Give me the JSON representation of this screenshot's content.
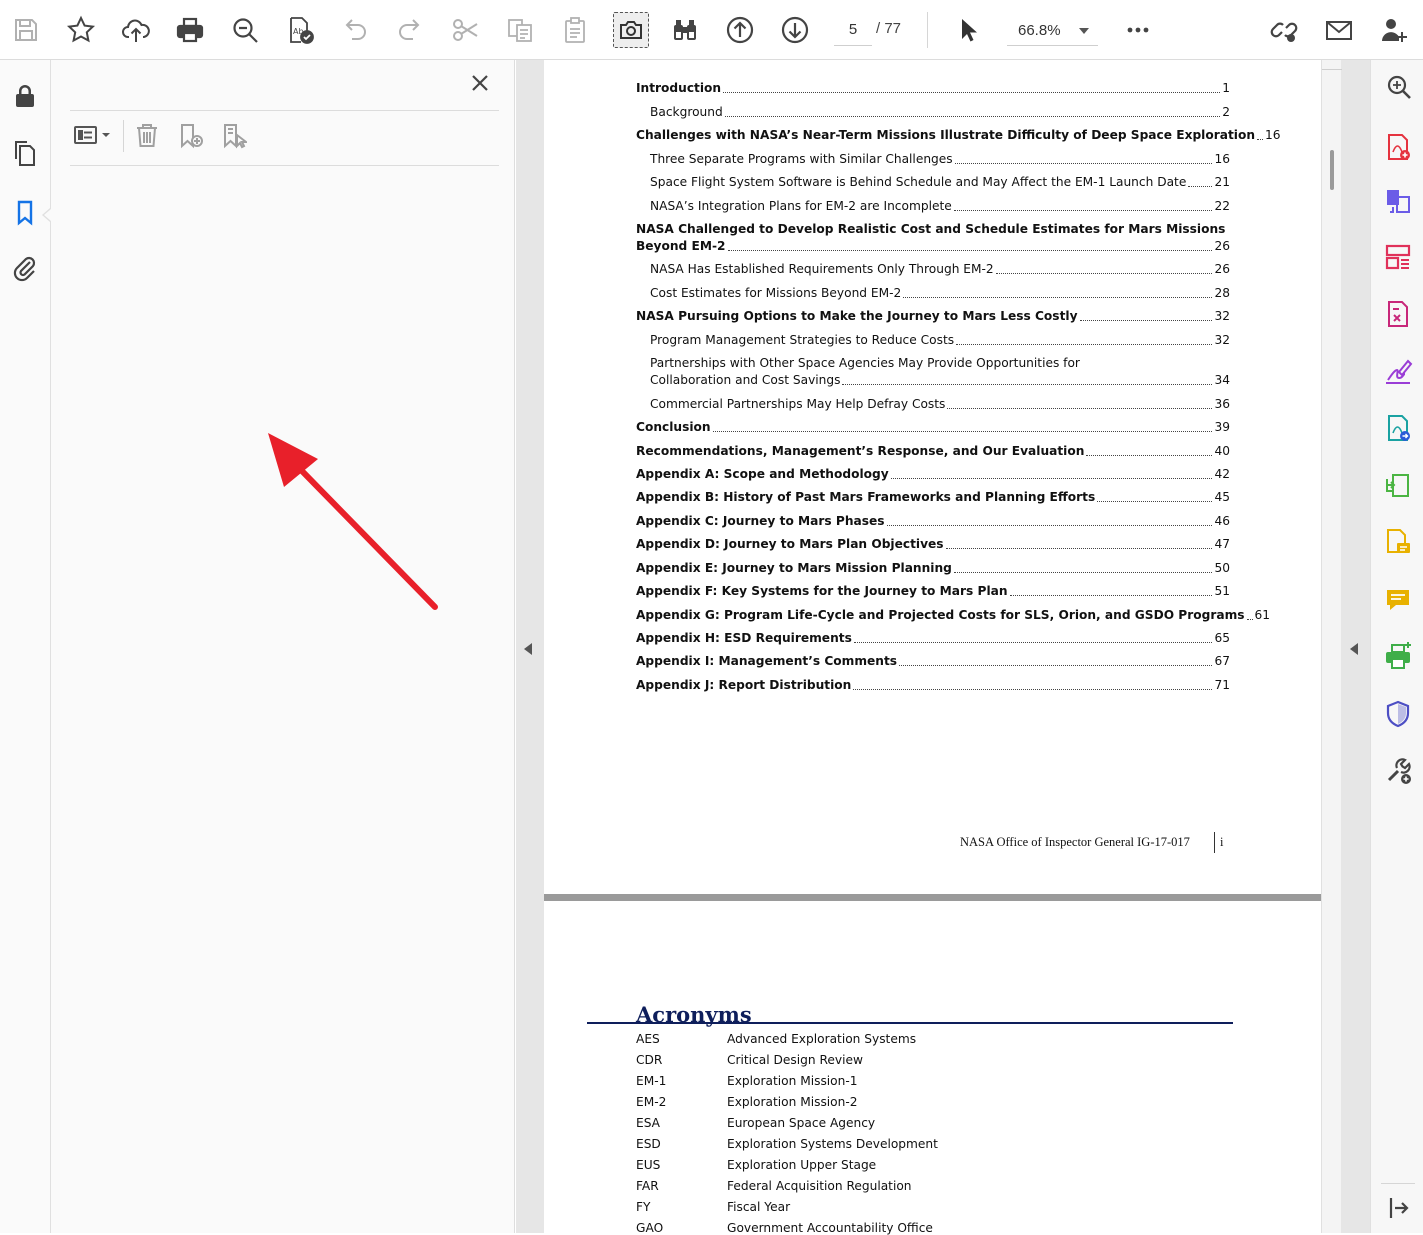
{
  "toolbar": {
    "buttons": [
      {
        "name": "save-icon"
      },
      {
        "name": "bookmark-star-icon"
      },
      {
        "name": "cloud-upload-icon"
      },
      {
        "name": "print-icon"
      },
      {
        "name": "zoom-search-icon"
      },
      {
        "name": "spellcheck-icon"
      },
      {
        "name": "undo-icon"
      },
      {
        "name": "redo-icon"
      },
      {
        "name": "cut-icon"
      },
      {
        "name": "copy-icon"
      },
      {
        "name": "paste-icon"
      },
      {
        "name": "snapshot-icon"
      },
      {
        "name": "find-binoculars-icon"
      },
      {
        "name": "previous-page-icon"
      },
      {
        "name": "next-page-icon"
      },
      {
        "name": "select-pointer-icon"
      },
      {
        "name": "more-options-icon"
      },
      {
        "name": "share-link-icon"
      },
      {
        "name": "email-icon"
      },
      {
        "name": "add-user-icon"
      }
    ],
    "current_page": "5",
    "total_pages": "/ 77",
    "zoom": "66.8%"
  },
  "left_rail": {
    "items": [
      {
        "name": "security-lock-icon"
      },
      {
        "name": "page-thumbnails-icon"
      },
      {
        "name": "bookmarks-icon",
        "active": true
      },
      {
        "name": "attachments-paperclip-icon"
      }
    ]
  },
  "bookmarks_panel": {
    "tools": [
      "options-list-icon",
      "delete-bookmark-icon",
      "new-bookmark-icon",
      "new-bookmark-from-structure-icon"
    ]
  },
  "document": {
    "toc": [
      {
        "title": "Introduction",
        "page": "1",
        "level": 1
      },
      {
        "title": "Background",
        "page": "2",
        "level": 2
      },
      {
        "title": "Challenges with NASA’s Near-Term Missions Illustrate Difficulty of Deep Space Exploration",
        "page": "16",
        "level": 1
      },
      {
        "title": "Three Separate Programs with Similar Challenges",
        "page": "16",
        "level": 2
      },
      {
        "title": "Space Flight System Software is Behind Schedule and May Affect the EM-1 Launch Date",
        "page": "21",
        "level": 2
      },
      {
        "title": "NASA’s Integration Plans for EM-2 are Incomplete",
        "page": "22",
        "level": 2
      },
      {
        "title_line1": "NASA Challenged to Develop Realistic Cost and Schedule Estimates for Mars Missions",
        "title": "Beyond EM-2",
        "page": "26",
        "level": 1
      },
      {
        "title": "NASA Has Established Requirements Only Through EM-2",
        "page": "26",
        "level": 2
      },
      {
        "title": "Cost Estimates for Missions Beyond EM-2",
        "page": "28",
        "level": 2
      },
      {
        "title": "NASA Pursuing Options to Make the Journey to Mars Less Costly",
        "page": "32",
        "level": 1
      },
      {
        "title": "Program Management Strategies to Reduce Costs",
        "page": "32",
        "level": 2
      },
      {
        "title_line1": "Partnerships with Other Space Agencies May Provide Opportunities for",
        "title": "Collaboration and Cost Savings",
        "page": "34",
        "level": 2
      },
      {
        "title": "Commercial Partnerships May Help Defray Costs",
        "page": "36",
        "level": 2
      },
      {
        "title": "Conclusion",
        "page": "39",
        "level": 1
      },
      {
        "title": "Recommendations, Management’s Response, and Our Evaluation",
        "page": "40",
        "level": 1
      },
      {
        "title": "Appendix A:  Scope and Methodology",
        "page": "42",
        "level": 1
      },
      {
        "title": "Appendix B:  History of Past Mars Frameworks and Planning Efforts",
        "page": "45",
        "level": 1
      },
      {
        "title": "Appendix C:  Journey to Mars Phases",
        "page": "46",
        "level": 1
      },
      {
        "title": "Appendix D:  Journey to Mars Plan Objectives",
        "page": "47",
        "level": 1
      },
      {
        "title": "Appendix E:  Journey to Mars Mission  Planning",
        "page": "50",
        "level": 1
      },
      {
        "title": "Appendix F:  Key Systems for the Journey to Mars Plan",
        "page": "51",
        "level": 1
      },
      {
        "title": "Appendix G:  Program Life-Cycle and Projected Costs for SLS, Orion, and GSDO Programs",
        "page": "61",
        "level": 1
      },
      {
        "title": "Appendix H:  ESD Requirements",
        "page": "65",
        "level": 1
      },
      {
        "title": "Appendix I:  Management’s Comments",
        "page": "67",
        "level": 1
      },
      {
        "title": "Appendix J:  Report Distribution",
        "page": "71",
        "level": 1
      }
    ],
    "footer": {
      "org": "NASA Office of Inspector General    IG-17-017",
      "page": "i"
    },
    "acronyms_heading": "Acronyms",
    "acronyms": [
      {
        "abbr": "AES",
        "full": "Advanced Exploration Systems"
      },
      {
        "abbr": "CDR",
        "full": "Critical Design Review"
      },
      {
        "abbr": "EM-1",
        "full": "Exploration Mission-1"
      },
      {
        "abbr": "EM-2",
        "full": "Exploration Mission-2"
      },
      {
        "abbr": "ESA",
        "full": "European Space Agency"
      },
      {
        "abbr": "ESD",
        "full": "Exploration Systems Development"
      },
      {
        "abbr": "EUS",
        "full": "Exploration Upper Stage"
      },
      {
        "abbr": "FAR",
        "full": "Federal Acquisition Regulation"
      },
      {
        "abbr": "FY",
        "full": "Fiscal Year"
      },
      {
        "abbr": "GAO",
        "full": "Government Accountability Office"
      }
    ]
  },
  "right_rail": {
    "tools": [
      {
        "name": "search-tools-icon",
        "color": "#444444"
      },
      {
        "name": "create-pdf-icon",
        "color": "#e5333f"
      },
      {
        "name": "combine-files-icon",
        "color": "#6b5ce7"
      },
      {
        "name": "organize-pages-icon",
        "color": "#e0315a"
      },
      {
        "name": "export-pdf-icon",
        "color": "#c8277a"
      },
      {
        "name": "fill-sign-icon",
        "color": "#9a3dd6"
      },
      {
        "name": "send-for-review-icon",
        "color": "#1aa2a2"
      },
      {
        "name": "compress-pdf-icon",
        "color": "#4bb543"
      },
      {
        "name": "comment-doc-icon",
        "color": "#e8b100"
      },
      {
        "name": "comment-icon",
        "color": "#e8b100"
      },
      {
        "name": "print-production-icon",
        "color": "#3fae49"
      },
      {
        "name": "protect-shield-icon",
        "color": "#4d4fc4"
      },
      {
        "name": "more-tools-icon",
        "color": "#444444"
      },
      {
        "name": "collapse-pane-icon",
        "color": "#444444"
      }
    ]
  },
  "annotation": {
    "color": "#e8202a"
  }
}
